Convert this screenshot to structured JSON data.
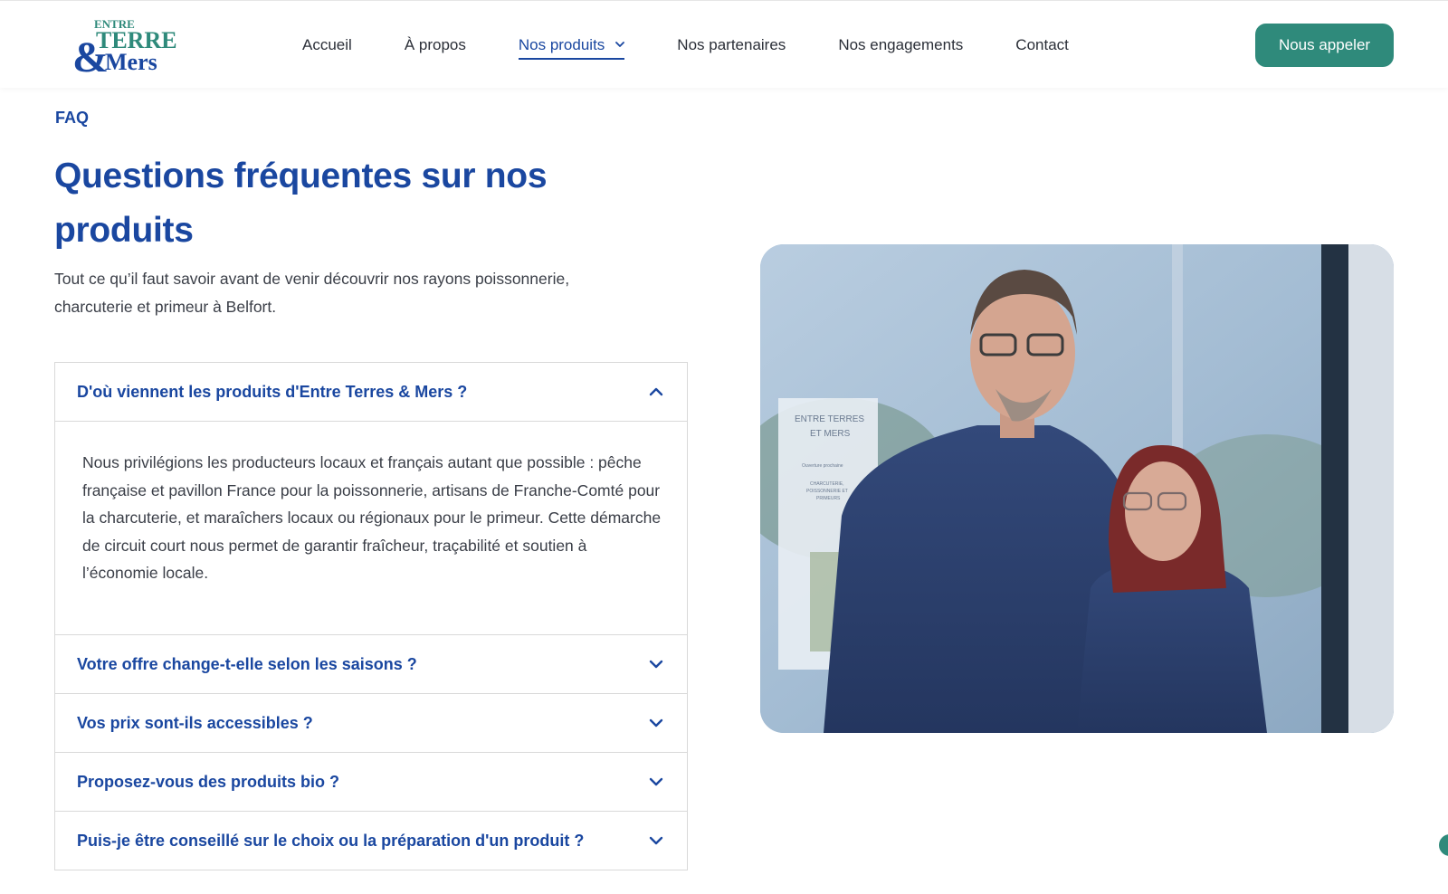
{
  "logo": {
    "alt": "Entre Terres & Mers",
    "line1": "ENTRE",
    "line2": "TERRES",
    "amp": "&",
    "line3": "Mers"
  },
  "nav": {
    "items": [
      {
        "label": "Accueil"
      },
      {
        "label": "À propos"
      },
      {
        "label": "Nos produits",
        "active": true,
        "has_dropdown": true
      },
      {
        "label": "Nos partenaires"
      },
      {
        "label": "Nos engagements"
      },
      {
        "label": "Contact"
      }
    ],
    "cta": "Nous appeler"
  },
  "page": {
    "eyebrow": "FAQ",
    "title": "Questions fréquentes sur nos produits",
    "intro": "Tout ce qu’il faut savoir avant de venir découvrir nos rayons poissonnerie, charcuterie et primeur à Belfort."
  },
  "faq": [
    {
      "question": "D'où viennent les produits d'Entre Terres & Mers ?",
      "expanded": true,
      "answer": "Nous privilégions les producteurs locaux et français autant que possible : pêche française et pavillon France pour la poissonnerie, artisans de Franche-Comté pour la charcuterie, et maraîchers locaux ou régionaux pour le primeur. Cette démarche de circuit court nous permet de garantir fraîcheur, traçabilité et soutien à l’économie locale."
    },
    {
      "question": "Votre offre change-t-elle selon les saisons ?",
      "expanded": false
    },
    {
      "question": "Vos prix sont-ils accessibles ?",
      "expanded": false
    },
    {
      "question": "Proposez-vous des produits bio ?",
      "expanded": false
    },
    {
      "question": "Puis-je être conseillé sur le choix ou la préparation d'un produit ?",
      "expanded": false
    }
  ],
  "photo": {
    "poster_line1": "ENTRE TERRES",
    "poster_line2": "ET MERS",
    "poster_line3": "Ouverture prochaine",
    "poster_line4": "CHARCUTERIE,",
    "poster_line5": "POISSONNERIE ET",
    "poster_line6": "PRIMEURS"
  },
  "colors": {
    "brand_blue": "#1a47a0",
    "brand_green": "#2f8a7b",
    "text": "#2b2f38",
    "border": "#d9d9d9"
  },
  "icons": {
    "dropdown": "chevron-down-icon",
    "expanded": "chevron-up-icon",
    "collapsed": "chevron-down-icon"
  }
}
